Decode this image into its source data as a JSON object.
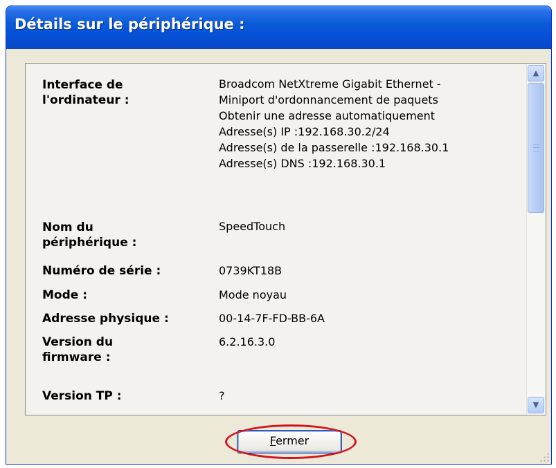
{
  "window": {
    "title": "Détails sur le périphérique :"
  },
  "details": [
    {
      "label": "Interface de l'ordinateur :",
      "value": [
        "Broadcom NetXtreme Gigabit Ethernet -",
        "Miniport d'ordonnancement de paquets",
        "Obtenir une adresse automatiquement",
        "Adresse(s) IP :192.168.30.2/24",
        "Adresse(s) de la passerelle :192.168.30.1",
        "Adresse(s) DNS :192.168.30.1"
      ]
    },
    {
      "label": "Nom du périphérique :",
      "value": [
        "SpeedTouch"
      ]
    },
    {
      "label": "Numéro de série :",
      "value": [
        "0739KT18B"
      ]
    },
    {
      "label": "Mode :",
      "value": [
        "Mode noyau"
      ]
    },
    {
      "label": "Adresse physique :",
      "value": [
        "00-14-7F-FD-BB-6A"
      ]
    },
    {
      "label": "Version du firmware :",
      "value": [
        "6.2.16.3.0"
      ]
    },
    {
      "label": "Version TP :",
      "value": [
        "?"
      ]
    }
  ],
  "footer": {
    "close_label": "Fermer",
    "close_mnemonic": "F",
    "close_rest": "ermer"
  },
  "icons": {
    "scroll_up": "chevron-up-icon",
    "scroll_down": "chevron-down-icon"
  },
  "colors": {
    "titlebar": "#0550d6",
    "highlight": "#d4141c"
  }
}
